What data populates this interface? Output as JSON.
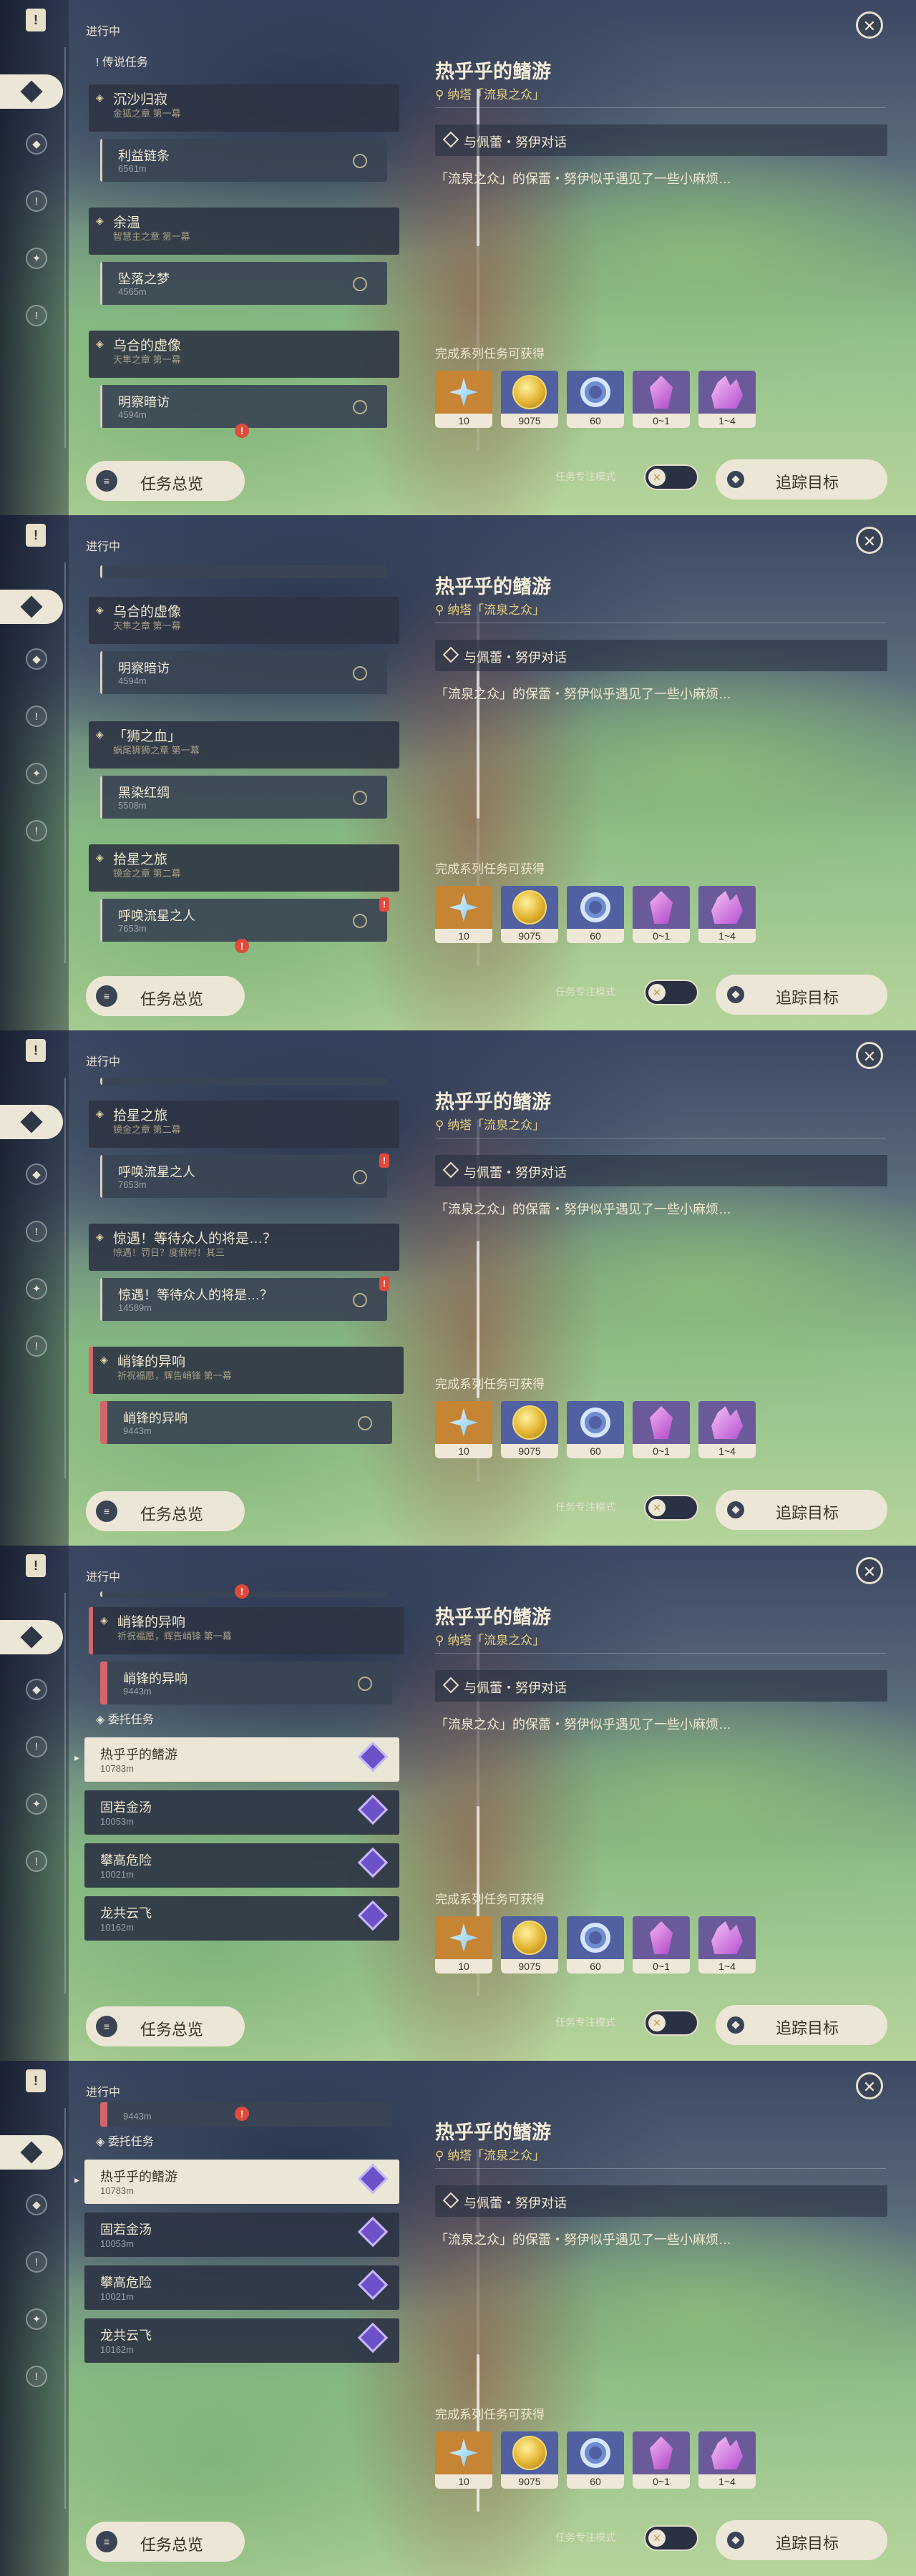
{
  "header": {
    "in_progress": "进行中",
    "close": "✕"
  },
  "sections": {
    "legend": "传说任务",
    "commission": "委托任务"
  },
  "quests": [
    {
      "name": "沉沙归寂",
      "chapter": "金狐之章 第一幕",
      "step": "利益链条",
      "dist": "6561m"
    },
    {
      "name": "余温",
      "chapter": "智慧主之章 第一幕",
      "step": "坠落之梦",
      "dist": "4565m"
    },
    {
      "name": "乌合的虚像",
      "chapter": "天隼之章 第一幕",
      "step": "明察暗访",
      "dist": "4594m"
    },
    {
      "name": "「狮之血」",
      "chapter": "蜗尾狮狮之章 第一幕",
      "step": "黑染红绸",
      "dist": "5508m"
    },
    {
      "name": "拾星之旅",
      "chapter": "镜金之章 第二幕",
      "step": "呼唤流星之人",
      "dist": "7653m"
    },
    {
      "name": "惊遇！等待众人的将是…？",
      "chapter": "惊遇！罚日？度假村！其三",
      "step": "惊遇！等待众人的将是…？",
      "dist": "14589m"
    },
    {
      "name": "峭锋的异响",
      "chapter": "祈祝福愿，辉告峭锋 第一幕",
      "step": "峭锋的异响",
      "dist": "9443m"
    }
  ],
  "commissions": [
    {
      "name": "热乎乎的鳍游",
      "dist": "10783m"
    },
    {
      "name": "固若金汤",
      "dist": "10053m"
    },
    {
      "name": "攀高危险",
      "dist": "10021m"
    },
    {
      "name": "龙共云飞",
      "dist": "10162m"
    }
  ],
  "detail": {
    "title": "热乎乎的鳍游",
    "location": "纳塔「流泉之众」",
    "objective": "与佩蕾・努伊对话",
    "description": "「流泉之众」的保蕾・努伊似乎遇见了一些小麻烦…",
    "reward_label": "完成系列任务可获得",
    "rewards": [
      {
        "icon": "primogem-icon",
        "value": "10"
      },
      {
        "icon": "mora-icon",
        "value": "9075"
      },
      {
        "icon": "adventure-exp-icon",
        "value": "60"
      },
      {
        "icon": "crystal-icon",
        "value": "0~1"
      },
      {
        "icon": "crystal-cluster-icon",
        "value": "1~4"
      }
    ]
  },
  "footer": {
    "overview": "任务总览",
    "focus_mode": "任务专注模式",
    "track": "追踪目标"
  }
}
